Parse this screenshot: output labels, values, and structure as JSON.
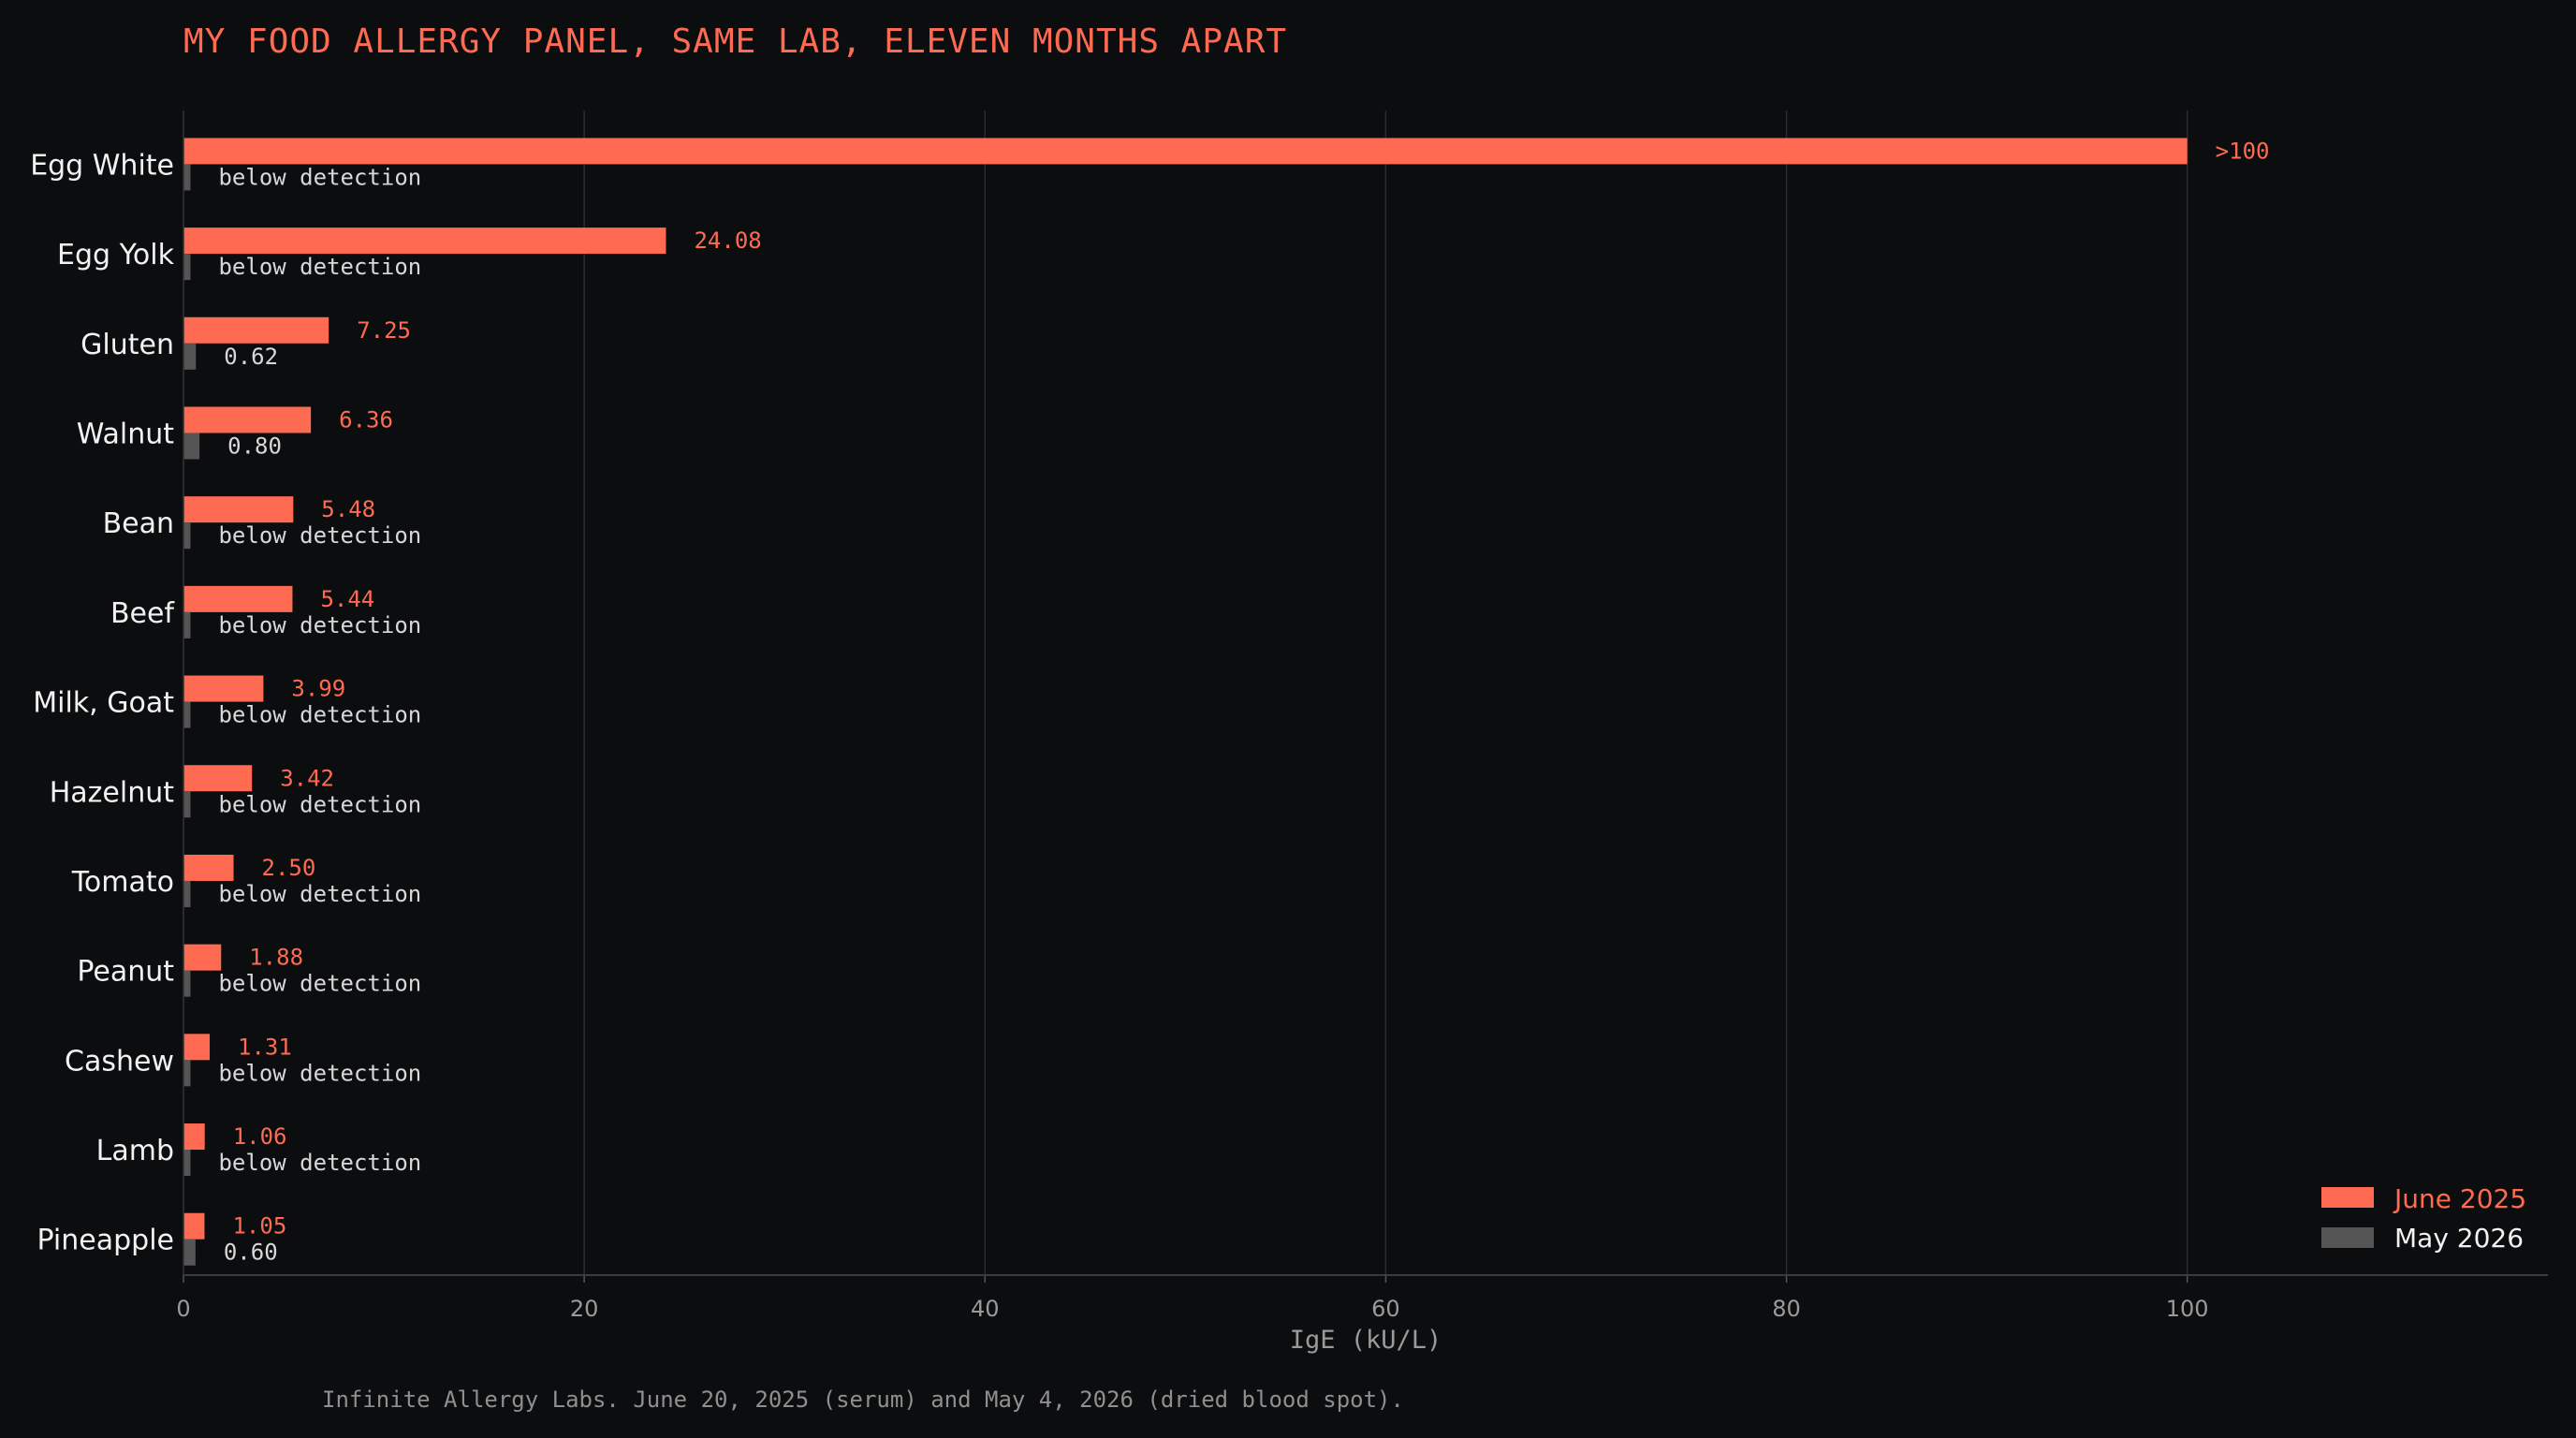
{
  "colors": {
    "background": "#0c0d0f",
    "series_a": "#ff6b52",
    "series_b": "#555555",
    "grid": "#2a2b2e"
  },
  "chart_data": {
    "type": "bar",
    "orientation": "horizontal",
    "title": "MY FOOD ALLERGY PANEL, SAME LAB, ELEVEN MONTHS APART",
    "xlabel": "IgE (kU/L)",
    "ylabel": "",
    "xlim": [
      0,
      118
    ],
    "xticks": [
      0,
      20,
      40,
      60,
      80,
      100
    ],
    "grid": "vertical",
    "legend_position": "bottom-right",
    "categories": [
      "Egg White",
      "Egg Yolk",
      "Gluten",
      "Walnut",
      "Bean",
      "Beef",
      "Milk, Goat",
      "Hazelnut",
      "Tomato",
      "Peanut",
      "Cashew",
      "Lamb",
      "Pineapple"
    ],
    "series": [
      {
        "name": "June 2025",
        "values": [
          100,
          24.08,
          7.25,
          6.36,
          5.48,
          5.44,
          3.99,
          3.42,
          2.5,
          1.88,
          1.31,
          1.06,
          1.05
        ],
        "labels": [
          ">100",
          "24.08",
          "7.25",
          "6.36",
          "5.48",
          "5.44",
          "3.99",
          "3.42",
          "2.50",
          "1.88",
          "1.31",
          "1.06",
          "1.05"
        ]
      },
      {
        "name": "May 2026",
        "values": [
          0.35,
          0.35,
          0.62,
          0.8,
          0.35,
          0.35,
          0.35,
          0.35,
          0.35,
          0.35,
          0.35,
          0.35,
          0.6
        ],
        "labels": [
          "below detection",
          "below detection",
          "0.62",
          "0.80",
          "below detection",
          "below detection",
          "below detection",
          "below detection",
          "below detection",
          "below detection",
          "below detection",
          "below detection",
          "0.60"
        ]
      }
    ],
    "footnote": "Infinite Allergy Labs. June 20, 2025 (serum) and May 4, 2026 (dried blood spot)."
  }
}
